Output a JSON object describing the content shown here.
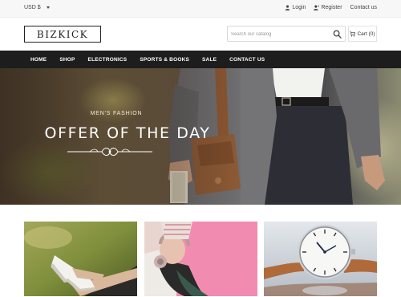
{
  "topbar": {
    "currency": "USD $",
    "links": [
      {
        "label": "Login",
        "icon": "user-icon"
      },
      {
        "label": "Register",
        "icon": "user-plus-icon"
      },
      {
        "label": "Contact us",
        "icon": ""
      }
    ]
  },
  "header": {
    "logo": "BIZKICK",
    "search_placeholder": "Search our catalog",
    "cart_label": "Cart (0)",
    "icons": {
      "search": "search-icon",
      "cart": "cart-icon"
    }
  },
  "nav": {
    "items": [
      "HOME",
      "SHOP",
      "ELECTRONICS",
      "SPORTS & BOOKS",
      "SALE",
      "CONTACT US"
    ]
  },
  "hero": {
    "subtitle": "MEN'S FASHION",
    "title": "OFFER OF THE DAY"
  },
  "products": {
    "tiles": [
      "sneakers-image",
      "headphones-image",
      "watch-image"
    ]
  },
  "colors": {
    "nav_background": "#1d1d1d",
    "topbar_background": "#f7f7f7",
    "tile1_background": "#7f8f3c",
    "tile2_background": "#f28bb0",
    "tile3_background": "#d6dce2"
  }
}
